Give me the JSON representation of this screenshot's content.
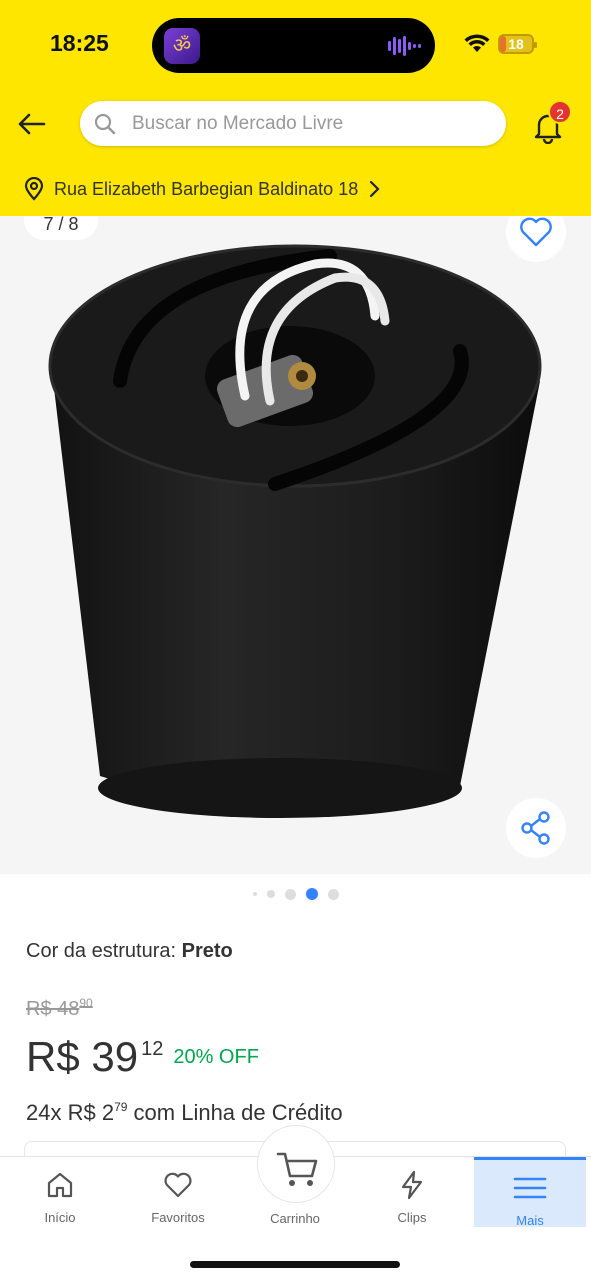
{
  "status_bar": {
    "time": "18:25",
    "battery": "18",
    "battery_level": 0.18
  },
  "header": {
    "search_placeholder": "Buscar no Mercado Livre",
    "notification_count": "2",
    "address": "Rua Elizabeth Barbegian Baldinato 18"
  },
  "gallery": {
    "counter": "7 / 8",
    "dots_total": 5,
    "dots_active_index": 3
  },
  "product": {
    "color_label": "Cor da estrutura: ",
    "color_value": "Preto",
    "old_price_main": "R$ 48",
    "old_price_cents": "90",
    "price_main": "R$ 39",
    "price_cents": "12",
    "discount": "20% OFF",
    "installments_prefix": "24x R$ 2",
    "installments_cents": "79",
    "installments_suffix": " com Linha de Crédito"
  },
  "bottom_nav": {
    "items": [
      {
        "label": "Início",
        "icon": "home-icon"
      },
      {
        "label": "Favoritos",
        "icon": "heart-icon"
      },
      {
        "label": "Carrinho",
        "icon": "cart-icon"
      },
      {
        "label": "Clips",
        "icon": "lightning-icon"
      },
      {
        "label": "Mais",
        "icon": "menu-icon"
      }
    ],
    "active": "Mais"
  },
  "colors": {
    "brand_yellow": "#fee600",
    "accent_blue": "#3483fa",
    "discount_green": "#00a650",
    "badge_red": "#e3342f"
  }
}
